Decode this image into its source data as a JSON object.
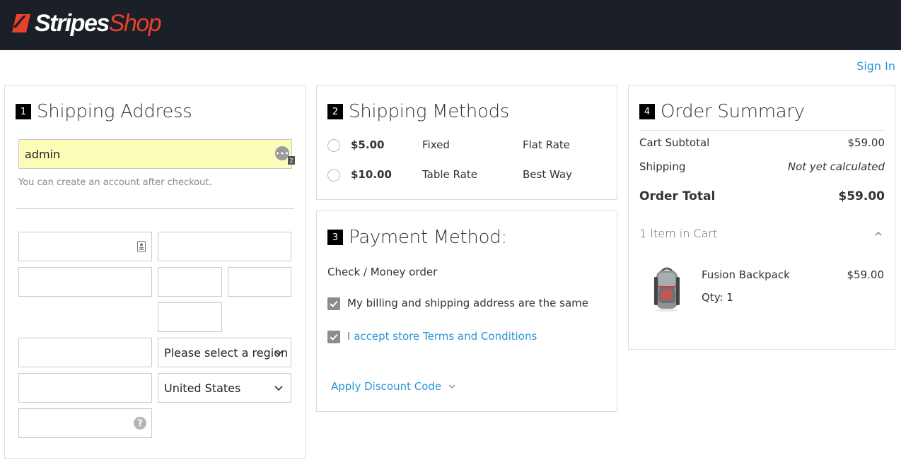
{
  "header": {
    "brand_primary": "Stripes",
    "brand_secondary": "Shop",
    "bg_color": "#1b1f27",
    "accent_color": "#e8412c"
  },
  "sign_in_label": "Sign In",
  "shipping_address": {
    "step": "1",
    "title": "Shipping Address",
    "email_value": "admin",
    "email_badge": "2",
    "hint": "You can create an account after checkout.",
    "region_select": "Please select a region",
    "country_select": "United States"
  },
  "shipping_methods": {
    "step": "2",
    "title": "Shipping Methods",
    "options": [
      {
        "price": "$5.00",
        "method": "Fixed",
        "carrier": "Flat Rate"
      },
      {
        "price": "$10.00",
        "method": "Table Rate",
        "carrier": "Best Way"
      }
    ]
  },
  "payment": {
    "step": "3",
    "title": "Payment Method:",
    "method": "Check / Money order",
    "same_address_label": "My billing and shipping address are the same",
    "terms_label": "I accept store Terms and Conditions",
    "discount_label": "Apply Discount Code"
  },
  "order_summary": {
    "step": "4",
    "title": "Order Summary",
    "subtotal_label": "Cart Subtotal",
    "subtotal_value": "$59.00",
    "shipping_label": "Shipping",
    "shipping_value": "Not yet calculated",
    "total_label": "Order Total",
    "total_value": "$59.00",
    "items_in_cart": "1 Item in Cart",
    "items": [
      {
        "name": "Fusion Backpack",
        "price": "$59.00",
        "qty": "Qty: 1"
      }
    ]
  }
}
